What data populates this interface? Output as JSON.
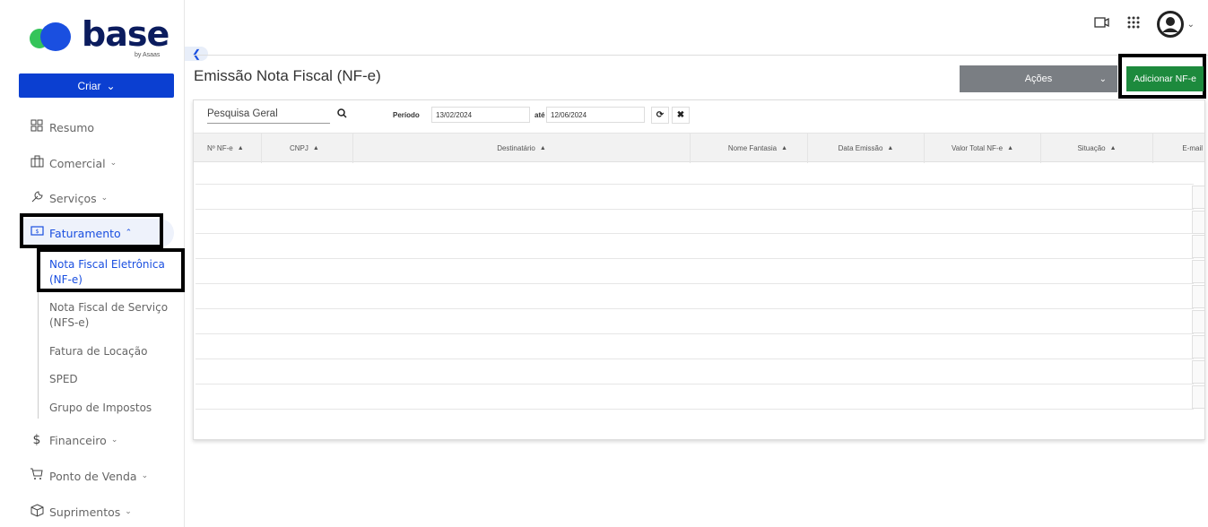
{
  "logo": {
    "word": "base",
    "sub": "by Asaas"
  },
  "sidebar": {
    "criar_label": "Criar",
    "items": [
      {
        "label": "Resumo",
        "icon": "dashboard-icon"
      },
      {
        "label": "Comercial",
        "icon": "briefcase-icon"
      },
      {
        "label": "Serviços",
        "icon": "wrench-icon"
      },
      {
        "label": "Faturamento",
        "icon": "billing-icon"
      },
      {
        "label": "Financeiro",
        "icon": "dollar-icon"
      },
      {
        "label": "Ponto de Venda",
        "icon": "cart-icon"
      },
      {
        "label": "Suprimentos",
        "icon": "box-icon"
      }
    ],
    "subitems": [
      {
        "label": "Nota Fiscal Eletrônica (NF-e)"
      },
      {
        "label": "Nota Fiscal de Serviço (NFS-e)"
      },
      {
        "label": "Fatura de Locação"
      },
      {
        "label": "SPED"
      },
      {
        "label": "Grupo de Impostos"
      }
    ]
  },
  "header": {
    "title": "Emissão Nota Fiscal (NF-e)",
    "acoes_label": "Ações",
    "add_label": "Adicionar NF-e"
  },
  "filters": {
    "search_placeholder": "Pesquisa Geral",
    "periodo_label": "Período",
    "date_from": "13/02/2024",
    "ate_label": "até",
    "date_to": "12/06/2024"
  },
  "table": {
    "columns": [
      "Nº NF-e",
      "CNPJ",
      "Destinatário",
      "Nome Fantasia",
      "Data Emissão",
      "Valor Total NF-e",
      "Situação",
      "E-mail"
    ]
  },
  "colors": {
    "primary": "#0b3fd1",
    "add_button": "#1d8a3d",
    "acoes_button": "#7a7e83",
    "active_link": "#1a4fe0"
  }
}
